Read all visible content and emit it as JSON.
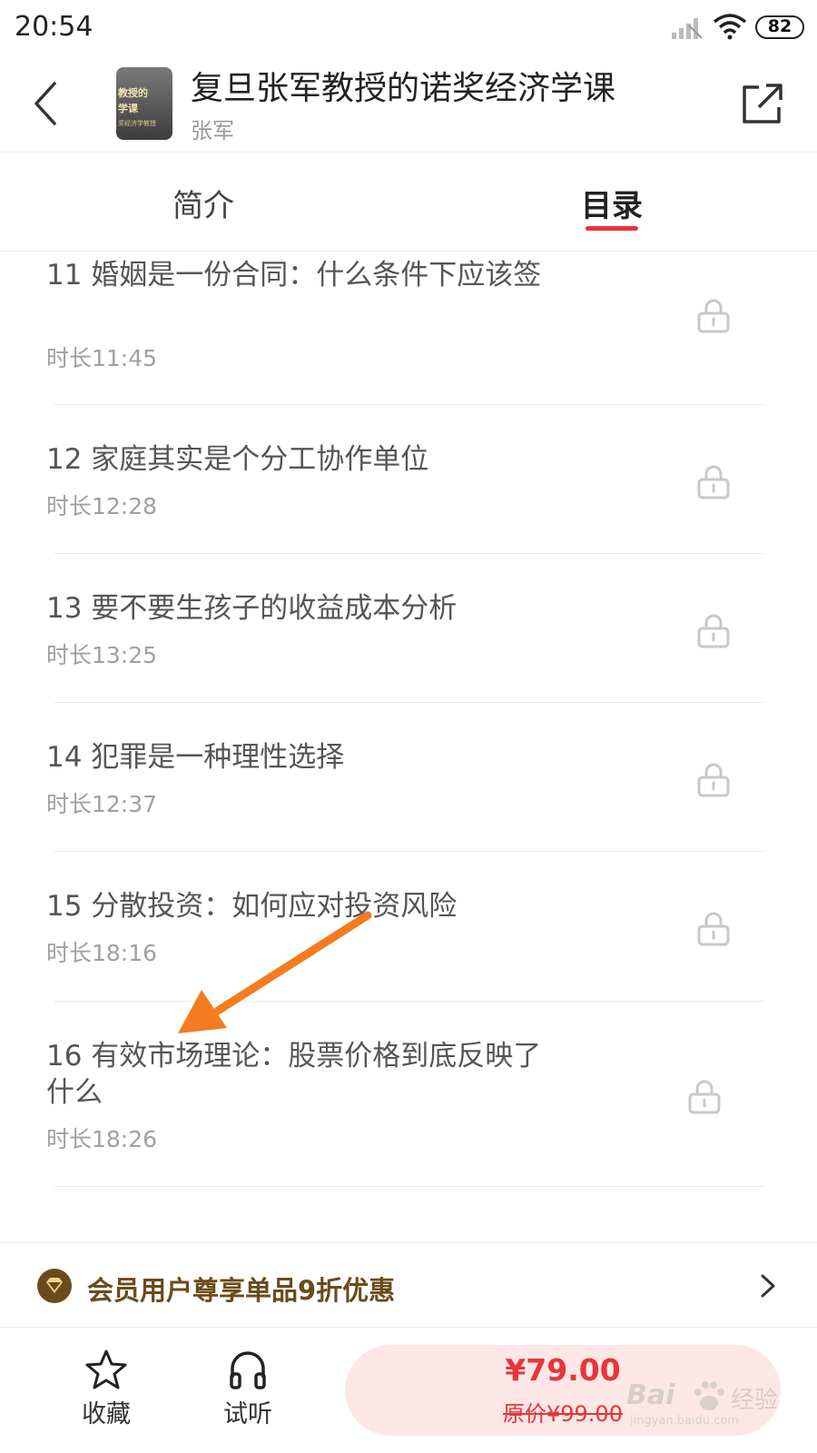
{
  "status_bar": {
    "time": "20:54",
    "battery": "82"
  },
  "header": {
    "title": "复旦张军教授的诺奖经济学课",
    "author": "张军",
    "cover_text": [
      "教授的",
      "学课",
      "奖经济学教授"
    ]
  },
  "tabs": [
    {
      "label": "简介",
      "active": false
    },
    {
      "label": "目录",
      "active": true
    }
  ],
  "episodes": [
    {
      "title": "11 婚姻是一份合同：什么条件下应该签",
      "duration": "时长11:45",
      "locked": true
    },
    {
      "title": "12 家庭其实是个分工协作单位",
      "duration": "时长12:28",
      "locked": true
    },
    {
      "title": "13 要不要生孩子的收益成本分析",
      "duration": "时长13:25",
      "locked": true
    },
    {
      "title": "14 犯罪是一种理性选择",
      "duration": "时长12:37",
      "locked": true
    },
    {
      "title": "15 分散投资：如何应对投资风险",
      "duration": "时长18:16",
      "locked": true
    },
    {
      "title": "16 有效市场理论：股票价格到底反映了什么",
      "duration": "时长18:26",
      "locked": true
    }
  ],
  "member_banner": {
    "text": "会员用户尊享单品9折优惠"
  },
  "bottom_bar": {
    "collect_label": "收藏",
    "listen_label": "试听",
    "price": "¥79.00",
    "original_price": "原价¥99.00"
  },
  "watermark": {
    "logo": "Bai",
    "brand": "经验",
    "url": "jingyan.baidu.com"
  },
  "colors": {
    "accent": "#e8343c",
    "member_gold": "#6b4b1a",
    "annotation_arrow": "#f47b20"
  }
}
